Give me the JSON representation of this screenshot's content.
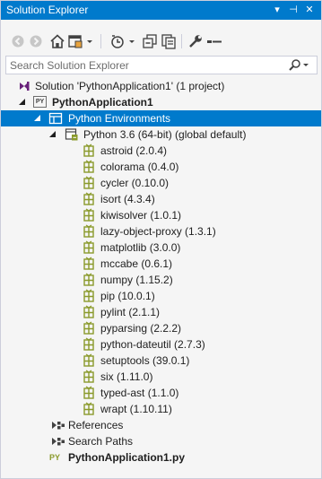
{
  "window": {
    "title": "Solution Explorer",
    "buttons": [
      "▾",
      "⊣",
      "✕"
    ]
  },
  "search": {
    "placeholder": "Search Solution Explorer"
  },
  "tree": {
    "solution": "Solution 'PythonApplication1' (1 project)",
    "project": "PythonApplication1",
    "environments": "Python Environments",
    "interpreter": "Python 3.6 (64-bit) (global default)",
    "packages": [
      "astroid (2.0.4)",
      "colorama (0.4.0)",
      "cycler (0.10.0)",
      "isort (4.3.4)",
      "kiwisolver (1.0.1)",
      "lazy-object-proxy (1.3.1)",
      "matplotlib (3.0.0)",
      "mccabe (0.6.1)",
      "numpy (1.15.2)",
      "pip (10.0.1)",
      "pylint (2.1.1)",
      "pyparsing (2.2.2)",
      "python-dateutil (2.7.3)",
      "setuptools (39.0.1)",
      "six (1.11.0)",
      "typed-ast (1.1.0)",
      "wrapt (1.10.11)"
    ],
    "references": "References",
    "search_paths": "Search Paths",
    "file": "PythonApplication1.py",
    "py_badge": "PY"
  },
  "colors": {
    "accent": "#007acc",
    "package_icon": "#8a9a2b",
    "solution_icon": "#68217a"
  }
}
